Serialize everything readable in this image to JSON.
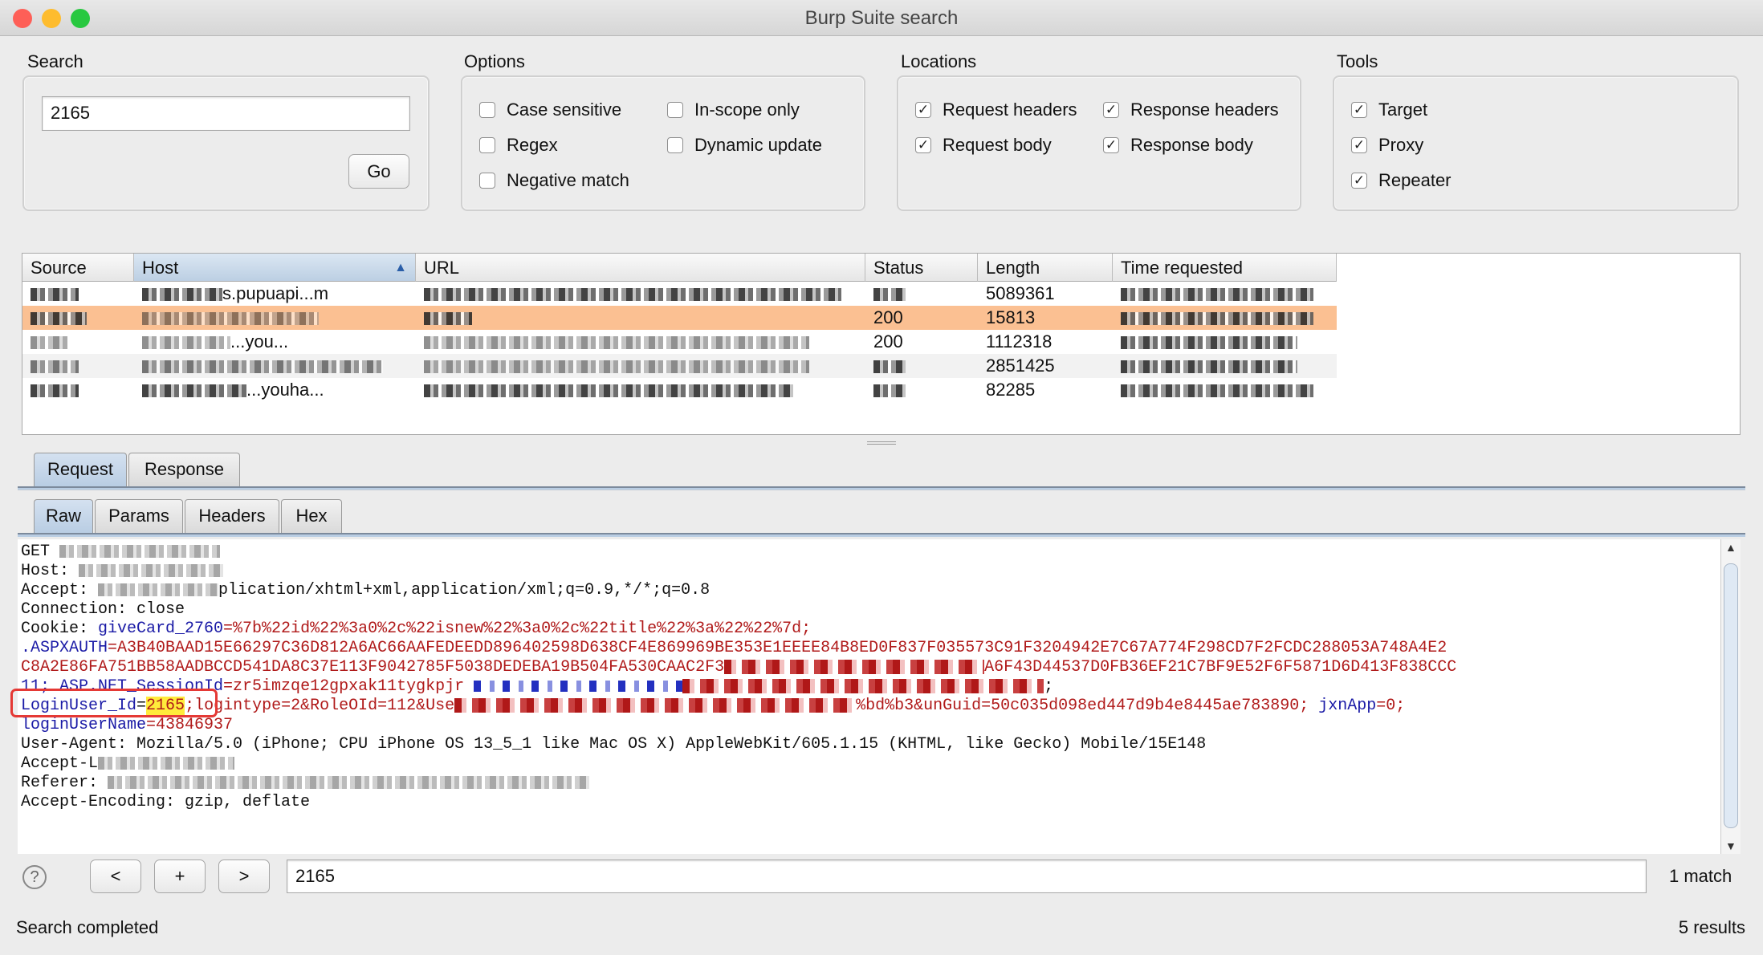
{
  "window": {
    "title": "Burp Suite search"
  },
  "search": {
    "label": "Search",
    "value": "2165",
    "go_label": "Go"
  },
  "options": {
    "label": "Options",
    "items": [
      {
        "label": "Case sensitive",
        "checked": false
      },
      {
        "label": "In-scope only",
        "checked": false
      },
      {
        "label": "Regex",
        "checked": false
      },
      {
        "label": "Dynamic update",
        "checked": false
      },
      {
        "label": "Negative match",
        "checked": false
      }
    ]
  },
  "locations": {
    "label": "Locations",
    "items": [
      {
        "label": "Request headers",
        "checked": true
      },
      {
        "label": "Response headers",
        "checked": true
      },
      {
        "label": "Request body",
        "checked": true
      },
      {
        "label": "Response body",
        "checked": true
      }
    ]
  },
  "tools": {
    "label": "Tools",
    "items": [
      {
        "label": "Target",
        "checked": true
      },
      {
        "label": "Proxy",
        "checked": true
      },
      {
        "label": "Repeater",
        "checked": true
      }
    ]
  },
  "results": {
    "columns": [
      "Source",
      "Host",
      "URL",
      "Status",
      "Length",
      "Time requested"
    ],
    "sort_column": "Host",
    "rows": [
      {
        "host_fragment": "s.pupuapi...m",
        "status": "",
        "length": "5089361"
      },
      {
        "host_fragment": "",
        "status": "200",
        "length": "15813",
        "selected": true
      },
      {
        "host_fragment": "...you...",
        "status": "200",
        "length": "1112318"
      },
      {
        "host_fragment": "",
        "status": "",
        "length": "2851425"
      },
      {
        "host_fragment": "...youha...",
        "status": "",
        "length": "82285"
      }
    ]
  },
  "message_tabs": [
    "Request",
    "Response"
  ],
  "view_tabs": [
    "Raw",
    "Params",
    "Headers",
    "Hex"
  ],
  "request": {
    "l1": "GET",
    "l2": "Host:",
    "l3a": "Accept:",
    "l3b": "plication/xhtml+xml,application/xml;q=0.9,*/*;q=0.8",
    "l4": "Connection: close",
    "l5a": "Cookie: ",
    "l5k": "giveCard_2760",
    "l5v": "=%7b%22id%22%3a0%2c%22isnew%22%3a0%2c%22title%22%3a%22%22%7d;",
    "l6k": ".ASPXAUTH",
    "l6v": "=A3B40BAAD15E66297C36D812A6AC66AAFEDEEDD896402598D638CF4E869969BE353E1EEEE84B8ED0F837F035573C91F3204942E7C67A774F298CD7F2FCDC288053A748A4E2",
    "l7a": "C8A2E86FA751BB58AADBCCD541DA8C37E113F9042785F5038DEDEBA19B504FA530CAAC2F3",
    "l7b": "A6F43D44537D0FB36EF21C7BF9E52F6F5871D6D413F838CCC",
    "l8k": "11; ASP.NET_SessionId",
    "l8v": "=zr5imzqe12gpxak11tygkpjr",
    "l8e": ";",
    "l9k": "LoginUser_Id",
    "l9eq": "=",
    "l9hit": "2165",
    "l9v": ";logintype=2&RoleOId=112&Use",
    "l9v2": "%bd%b3&unGuid=50c035d098ed447d9b4e8445ae783890;",
    "l9k2": " jxnApp",
    "l9v3": "=0;",
    "l10k": "loginUserName",
    "l10v": "=43846937",
    "l11": "User-Agent: Mozilla/5.0 (iPhone; CPU iPhone OS 13_5_1 like Mac OS X) AppleWebKit/605.1.15 (KHTML, like Gecko) Mobile/15E148",
    "l12": "Accept-L",
    "l13": "Referer:",
    "l14": "Accept-Encoding: gzip, deflate"
  },
  "find": {
    "help": "?",
    "prev": "<",
    "add": "+",
    "next": ">",
    "value": "2165",
    "matches": "1 match"
  },
  "status": {
    "text": "Search completed",
    "results": "5 results"
  },
  "colors": {
    "selected_row": "#fbc092",
    "highlight": "#ffeb3b",
    "key": "#1a1aa6",
    "value": "#b01a1a",
    "annotation": "#e53935"
  }
}
